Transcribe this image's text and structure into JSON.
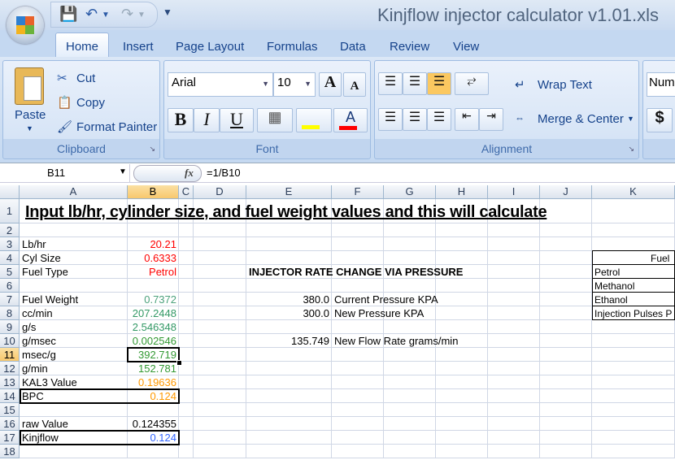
{
  "window": {
    "title": "Kinjflow injector calculator v1.01.xls"
  },
  "qat": {
    "save": "save-icon",
    "undo": "undo-icon",
    "redo": "redo-icon"
  },
  "tabs": [
    "Home",
    "Insert",
    "Page Layout",
    "Formulas",
    "Data",
    "Review",
    "View"
  ],
  "ribbon": {
    "clipboard": {
      "label": "Clipboard",
      "paste": "Paste",
      "cut": "Cut",
      "copy": "Copy",
      "format_painter": "Format Painter"
    },
    "font": {
      "label": "Font",
      "font_name": "Arial",
      "font_size": "10",
      "bold": "B",
      "italic": "I",
      "underline": "U",
      "grow": "A",
      "shrink": "A",
      "fill_color": "#ffff00",
      "font_color": "#ff0000"
    },
    "alignment": {
      "label": "Alignment",
      "wrap_text": "Wrap Text",
      "merge_center": "Merge & Center"
    },
    "number": {
      "format": "Num",
      "currency": "$"
    }
  },
  "formula_bar": {
    "name_box": "B11",
    "fx": "fx",
    "formula": "=1/B10"
  },
  "sheet": {
    "columns": [
      "A",
      "B",
      "C",
      "D",
      "E",
      "F",
      "G",
      "H",
      "I",
      "J",
      "K"
    ],
    "selected_column": "B",
    "selected_row": 11,
    "rows": [
      1,
      2,
      3,
      4,
      5,
      6,
      7,
      8,
      9,
      10,
      11,
      12,
      13,
      14,
      15,
      16,
      17,
      18
    ],
    "colors": {
      "input": "#ff0000",
      "calc": "#339966",
      "kal": "#ff9900",
      "kinjflow": "#3366ff"
    },
    "cells": [
      {
        "ref": "A1",
        "text": "Input lb/hr, cylinder size, and fuel weight values and this will calculate",
        "style": "title"
      },
      {
        "ref": "A3",
        "text": "Lb/hr"
      },
      {
        "ref": "B3",
        "text": "20.21",
        "align": "right",
        "color": "#ff0000"
      },
      {
        "ref": "A4",
        "text": "Cyl Size"
      },
      {
        "ref": "B4",
        "text": "0.6333",
        "align": "right",
        "color": "#ff0000"
      },
      {
        "ref": "A5",
        "text": "Fuel Type"
      },
      {
        "ref": "B5",
        "text": "Petrol",
        "align": "right",
        "color": "#ff0000"
      },
      {
        "ref": "A7",
        "text": "Fuel Weight"
      },
      {
        "ref": "B7",
        "text": "0.7372",
        "align": "right",
        "color": "#4ca27c"
      },
      {
        "ref": "A8",
        "text": "cc/min"
      },
      {
        "ref": "B8",
        "text": "207.2448",
        "align": "right",
        "color": "#339966"
      },
      {
        "ref": "A9",
        "text": "g/s"
      },
      {
        "ref": "B9",
        "text": "2.546348",
        "align": "right",
        "color": "#339966"
      },
      {
        "ref": "A10",
        "text": "g/msec"
      },
      {
        "ref": "B10",
        "text": "0.002546",
        "align": "right",
        "color": "#339933"
      },
      {
        "ref": "A11",
        "text": "msec/g"
      },
      {
        "ref": "B11",
        "text": "392.719",
        "align": "right",
        "color": "#339933"
      },
      {
        "ref": "A12",
        "text": "g/min"
      },
      {
        "ref": "B12",
        "text": "152.781",
        "align": "right",
        "color": "#339933"
      },
      {
        "ref": "A13",
        "text": "KAL3 Value"
      },
      {
        "ref": "B13",
        "text": "0.19636",
        "align": "right",
        "color": "#ff9900"
      },
      {
        "ref": "A14",
        "text": "BPC"
      },
      {
        "ref": "B14",
        "text": "0.124",
        "align": "right",
        "color": "#ff9900"
      },
      {
        "ref": "A16",
        "text": "raw Value"
      },
      {
        "ref": "B16",
        "text": "0.124355",
        "align": "right"
      },
      {
        "ref": "A17",
        "text": "Kinjflow"
      },
      {
        "ref": "B17",
        "text": "0.124",
        "align": "right",
        "color": "#3366ff"
      },
      {
        "ref": "E5",
        "text": "INJECTOR RATE CHANGE VIA PRESSURE",
        "bold": true
      },
      {
        "ref": "E7",
        "text": "380.0",
        "align": "right"
      },
      {
        "ref": "F7",
        "text": "Current Pressure KPA"
      },
      {
        "ref": "E8",
        "text": "300.0",
        "align": "right"
      },
      {
        "ref": "F8",
        "text": "New Pressure KPA"
      },
      {
        "ref": "E10",
        "text": "135.749",
        "align": "right"
      },
      {
        "ref": "F10",
        "text": "New Flow Rate grams/min"
      },
      {
        "ref": "K4",
        "text": "Fuel",
        "align": "center"
      },
      {
        "ref": "K5",
        "text": "Petrol"
      },
      {
        "ref": "K6",
        "text": "Methanol"
      },
      {
        "ref": "K7",
        "text": "Ethanol"
      },
      {
        "ref": "K8",
        "text": "Injection Pulses P"
      }
    ]
  }
}
